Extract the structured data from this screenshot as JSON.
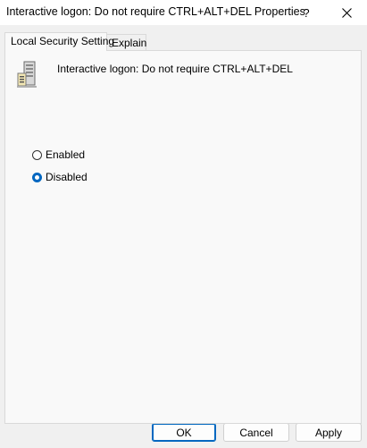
{
  "window": {
    "title": "Interactive logon: Do not require CTRL+ALT+DEL Properties",
    "help_label": "?"
  },
  "tabs": [
    {
      "label": "Local Security Setting",
      "active": true
    },
    {
      "label": "Explain",
      "active": false
    }
  ],
  "policy": {
    "name": "Interactive logon: Do not require CTRL+ALT+DEL",
    "icon": "server-policy-icon"
  },
  "options": [
    {
      "label": "Enabled",
      "checked": false
    },
    {
      "label": "Disabled",
      "checked": true
    }
  ],
  "buttons": {
    "ok": "OK",
    "cancel": "Cancel",
    "apply": "Apply"
  },
  "colors": {
    "accent": "#0067c0",
    "dialog_background": "#f0f0f0",
    "panel_background": "#f9f9f9"
  }
}
